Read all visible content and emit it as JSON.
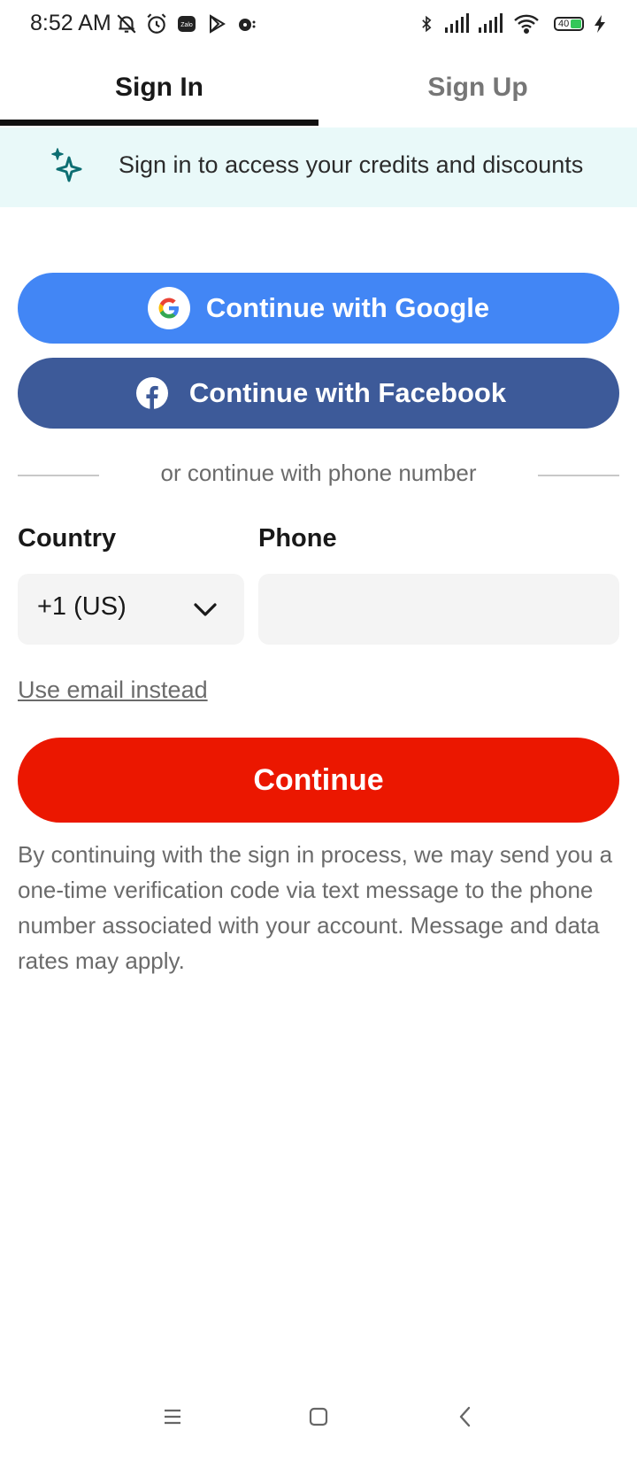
{
  "status_bar": {
    "time": "8:52 AM",
    "battery": "40",
    "icons": [
      "muted-notification-icon",
      "alarm-icon",
      "zalo-icon",
      "play-store-icon",
      "media-icon",
      "bluetooth-icon",
      "signal-icon",
      "signal-icon",
      "wifi-icon",
      "battery-icon",
      "charging-icon"
    ]
  },
  "tabs": [
    {
      "label": "Sign In",
      "active": true
    },
    {
      "label": "Sign Up",
      "active": false
    }
  ],
  "banner": {
    "text": "Sign in to access your credits and discounts",
    "icon": "sparkle-icon",
    "icon_color": "#0d6e72",
    "background": "#e9f9f9"
  },
  "buttons": {
    "google_label": "Continue with Google",
    "facebook_label": "Continue with Facebook",
    "continue_label": "Continue"
  },
  "divider_text": "or continue with phone number",
  "form": {
    "country_label": "Country",
    "phone_label": "Phone",
    "country_value": "+1 (US)",
    "phone_value": "",
    "email_link": "Use email instead"
  },
  "disclaimer": "By continuing with the sign in process, we may send you a one-time verification code via text message to the phone number associated with your account. Message and data rates may apply.",
  "colors": {
    "google": "#4286f5",
    "facebook": "#3d5a99",
    "continue": "#eb1700",
    "active_tab_underline": "#111111"
  },
  "nav_bar": {
    "icons": [
      "menu-icon",
      "home-icon",
      "back-icon"
    ]
  }
}
